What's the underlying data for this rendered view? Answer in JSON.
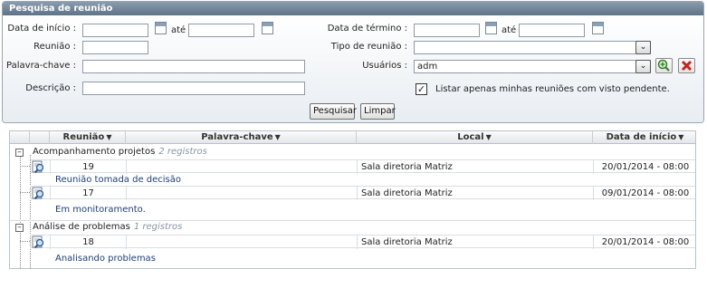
{
  "search": {
    "title": "Pesquisa de reunião",
    "date_start_label": "Data de início :",
    "date_start_from": "",
    "ate_label": "até",
    "date_start_to": "",
    "date_end_label": "Data de término :",
    "date_end_from": "",
    "date_end_to": "",
    "meeting_label": "Reunião :",
    "meeting_value": "",
    "meeting_type_label": "Tipo de reunião :",
    "meeting_type_value": "",
    "keyword_label": "Palavra-chave :",
    "keyword_value": "",
    "users_label": "Usuários :",
    "users_value": "adm",
    "description_label": "Descrição :",
    "description_value": "",
    "pending_checkbox_label": "Listar apenas minhas reuniões com visto pendente.",
    "pending_checked": true,
    "search_button": "Pesquisar",
    "clear_button": "Limpar"
  },
  "grid": {
    "columns": {
      "meeting": "Reunião",
      "keyword": "Palavra-chave",
      "location": "Local",
      "start_date": "Data de início"
    },
    "groups": [
      {
        "name": "Acompanhamento projetos",
        "count": "2 registros",
        "rows": [
          {
            "id": "19",
            "keyword": "",
            "location": "Sala diretoria Matriz",
            "start_date": "20/01/2014 - 08:00",
            "description": "Reunião tomada de decisão"
          },
          {
            "id": "17",
            "keyword": "",
            "location": "Sala diretoria Matriz",
            "start_date": "09/01/2014 - 08:00",
            "description": "Em monitoramento."
          }
        ]
      },
      {
        "name": "Análise de problemas",
        "count": "1 registros",
        "rows": [
          {
            "id": "18",
            "keyword": "",
            "location": "Sala diretoria Matriz",
            "start_date": "20/01/2014 - 08:00",
            "description": "Analisando problemas"
          }
        ]
      }
    ]
  }
}
